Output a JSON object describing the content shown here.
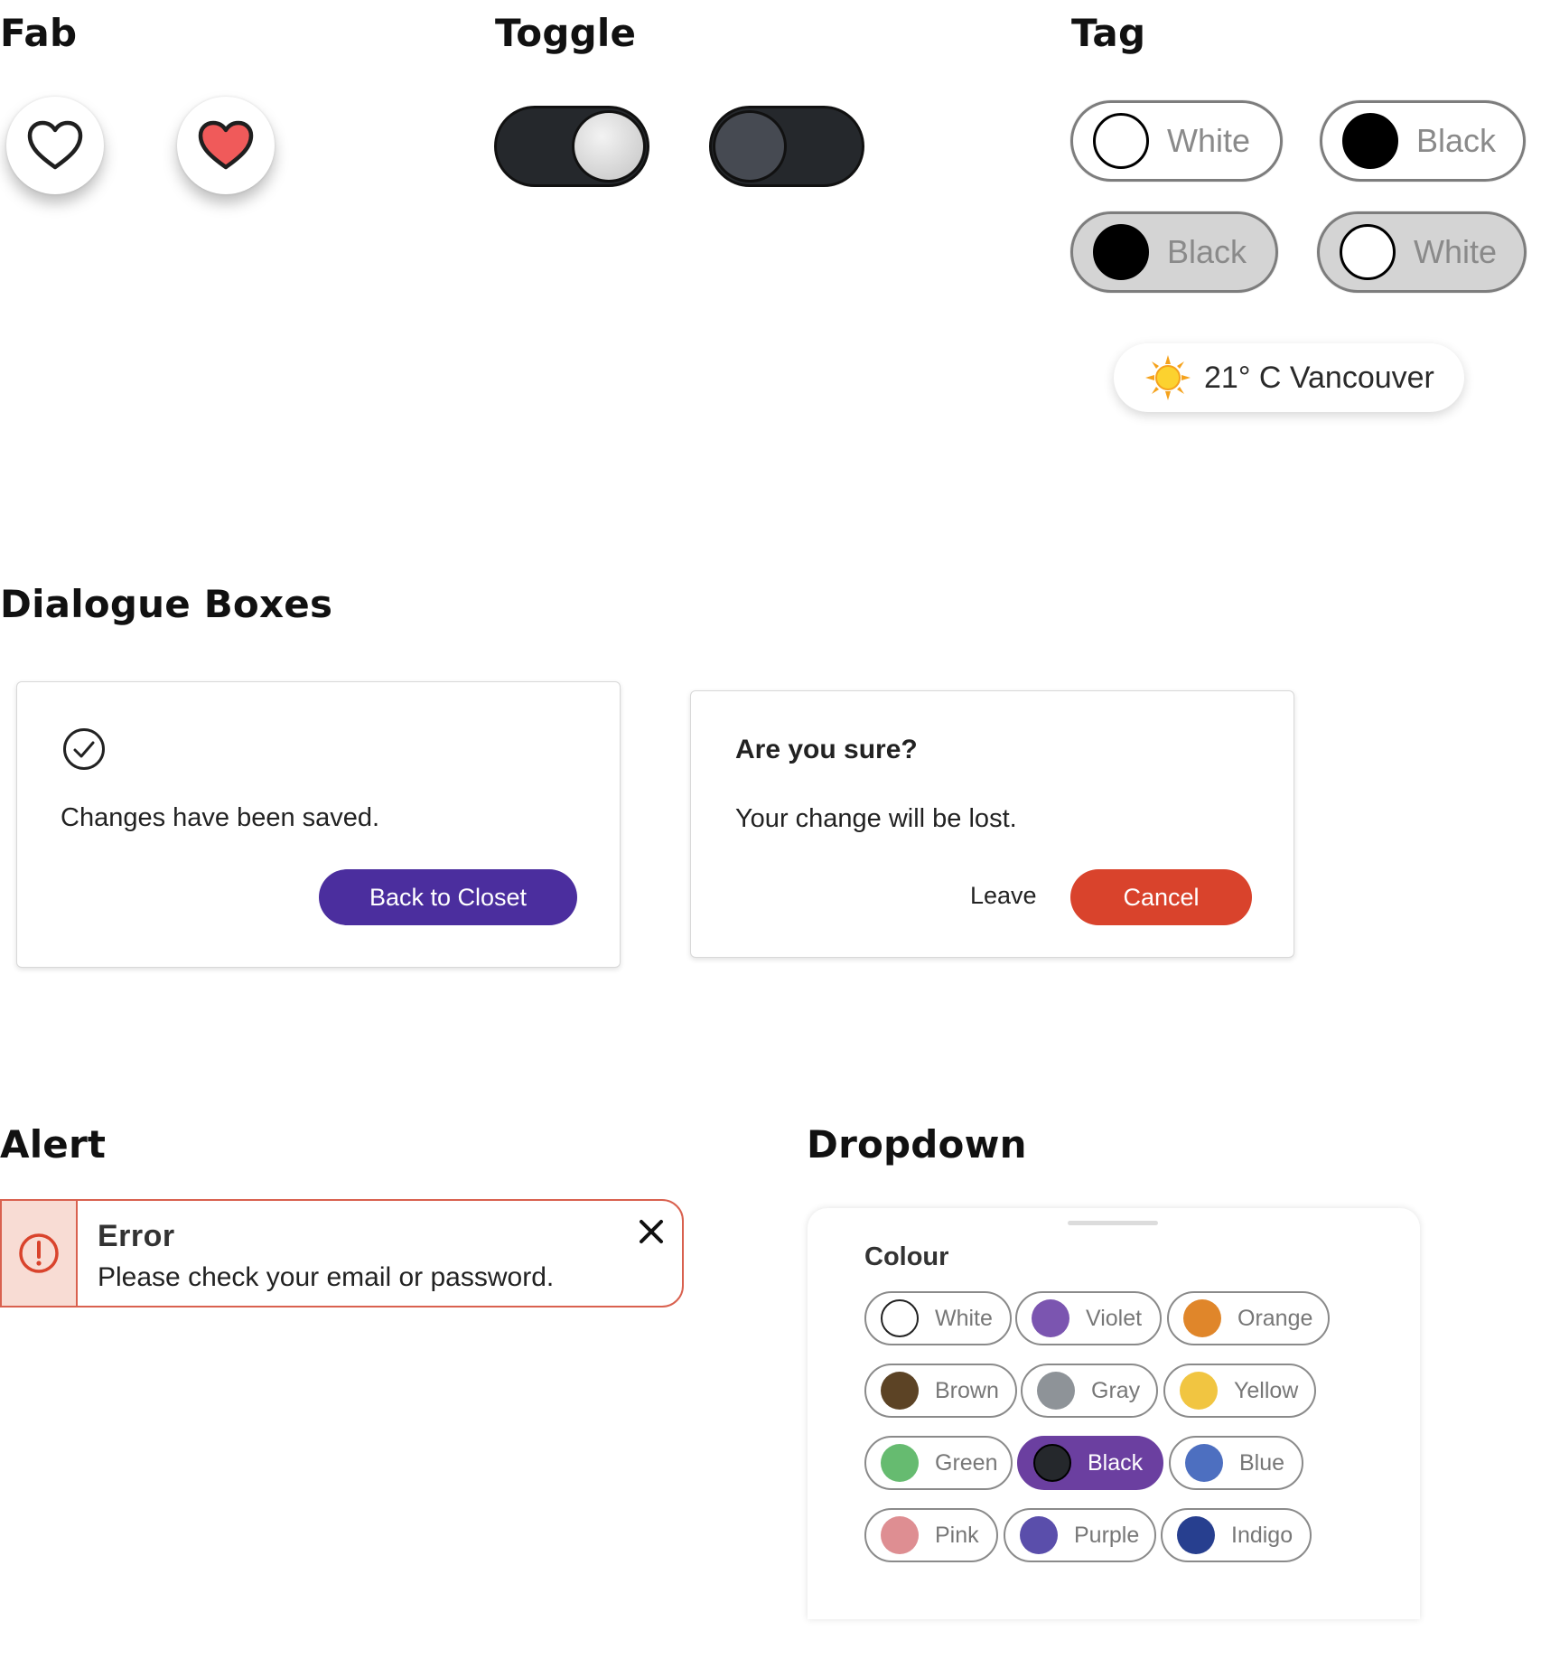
{
  "sections": {
    "fab": "Fab",
    "toggle": "Toggle",
    "tag": "Tag",
    "dialogue": "Dialogue Boxes",
    "alert": "Alert",
    "dropdown": "Dropdown"
  },
  "fab": {
    "unfilled_icon": "heart-outline-icon",
    "filled_icon": "heart-filled-icon",
    "filled_color": "#f05a5a"
  },
  "toggles": [
    {
      "state": "on"
    },
    {
      "state": "off"
    }
  ],
  "tags": [
    {
      "label": "White",
      "dot": "#ffffff",
      "style": "light"
    },
    {
      "label": "Black",
      "dot": "#000000",
      "style": "light"
    },
    {
      "label": "Black",
      "dot": "#000000",
      "style": "dark"
    },
    {
      "label": "White",
      "dot": "#ffffff",
      "style": "dark"
    }
  ],
  "weather": {
    "icon": "sun-icon",
    "label": "21° C Vancouver"
  },
  "dialog_saved": {
    "icon": "check-circle-icon",
    "message": "Changes have been saved.",
    "button": "Back to Closet",
    "button_color": "#4b2e9e"
  },
  "dialog_confirm": {
    "title": "Are you sure?",
    "message": "Your change will be lost.",
    "leave": "Leave",
    "cancel": "Cancel",
    "cancel_color": "#d9432c"
  },
  "alert": {
    "icon": "error-circle-icon",
    "title": "Error",
    "message": "Please check your email or password.",
    "close_icon": "close-icon"
  },
  "dropdown": {
    "title": "Colour",
    "selected": "Black",
    "options": [
      {
        "label": "White",
        "color": "#ffffff"
      },
      {
        "label": "Violet",
        "color": "#7b55b0"
      },
      {
        "label": "Orange",
        "color": "#e0862a"
      },
      {
        "label": "Brown",
        "color": "#5c4325"
      },
      {
        "label": "Gray",
        "color": "#8e9398"
      },
      {
        "label": "Yellow",
        "color": "#f1c541"
      },
      {
        "label": "Green",
        "color": "#66bb70"
      },
      {
        "label": "Black",
        "color": "#25282c"
      },
      {
        "label": "Blue",
        "color": "#4d6fc0"
      },
      {
        "label": "Pink",
        "color": "#de8e92"
      },
      {
        "label": "Purple",
        "color": "#5a4eab"
      },
      {
        "label": "Indigo",
        "color": "#273f8f"
      }
    ]
  }
}
